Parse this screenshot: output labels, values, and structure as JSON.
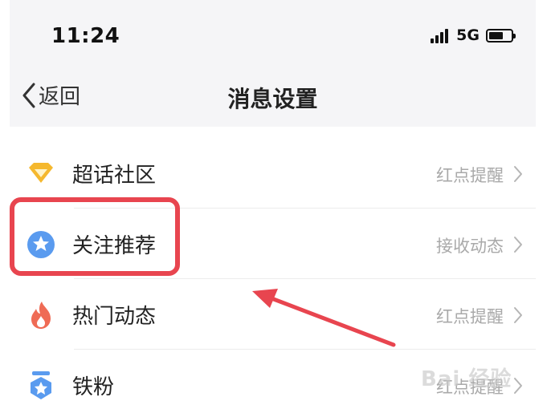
{
  "status_bar": {
    "time": "11:24",
    "network": "5G"
  },
  "nav": {
    "back_label": "返回",
    "title": "消息设置"
  },
  "settings": [
    {
      "label": "超话社区",
      "value": "红点提醒",
      "icon": "diamond-icon",
      "icon_color": "#f5b82e"
    },
    {
      "label": "关注推荐",
      "value": "接收动态",
      "icon": "star-badge-icon",
      "icon_color": "#5a9bef"
    },
    {
      "label": "热门动态",
      "value": "红点提醒",
      "icon": "flame-icon",
      "icon_color": "#ef6b55"
    },
    {
      "label": "铁粉",
      "value": "红点提醒",
      "icon": "fan-medal-icon",
      "icon_color": "#5a9bef"
    }
  ],
  "annotation": {
    "highlight_color": "#e8454f",
    "arrow_color": "#e8454f"
  },
  "watermark": {
    "text": "Bai 经验"
  }
}
